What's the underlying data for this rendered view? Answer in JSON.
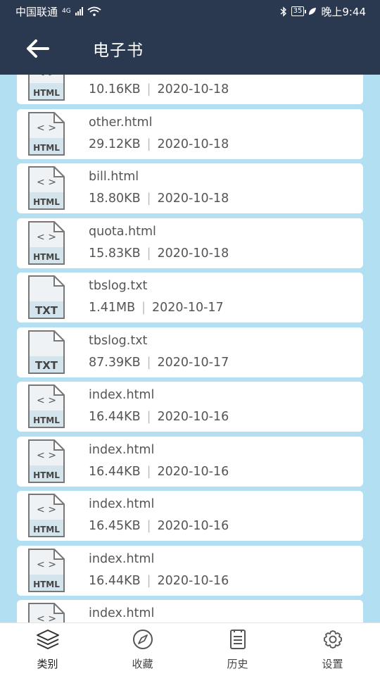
{
  "status": {
    "carrier": "中国联通",
    "net_label": "4G",
    "battery": "35",
    "time": "晚上9:44"
  },
  "header": {
    "title": "电子书",
    "back_icon": "arrow-left-icon"
  },
  "files": [
    {
      "name": "",
      "size": "10.16KB",
      "date": "2020-10-18",
      "type": "HTML"
    },
    {
      "name": "other.html",
      "size": "29.12KB",
      "date": "2020-10-18",
      "type": "HTML"
    },
    {
      "name": "bill.html",
      "size": "18.80KB",
      "date": "2020-10-18",
      "type": "HTML"
    },
    {
      "name": "quota.html",
      "size": "15.83KB",
      "date": "2020-10-18",
      "type": "HTML"
    },
    {
      "name": "tbslog.txt",
      "size": "1.41MB",
      "date": "2020-10-17",
      "type": "TXT"
    },
    {
      "name": "tbslog.txt",
      "size": "87.39KB",
      "date": "2020-10-17",
      "type": "TXT"
    },
    {
      "name": "index.html",
      "size": "16.44KB",
      "date": "2020-10-16",
      "type": "HTML"
    },
    {
      "name": "index.html",
      "size": "16.44KB",
      "date": "2020-10-16",
      "type": "HTML"
    },
    {
      "name": "index.html",
      "size": "16.45KB",
      "date": "2020-10-16",
      "type": "HTML"
    },
    {
      "name": "index.html",
      "size": "16.44KB",
      "date": "2020-10-16",
      "type": "HTML"
    },
    {
      "name": "index.html",
      "size": "",
      "date": "",
      "type": "HTML"
    }
  ],
  "meta_separator": "|",
  "nav": [
    {
      "label": "类别",
      "icon": "layers-icon",
      "active": true
    },
    {
      "label": "收藏",
      "icon": "compass-icon",
      "active": false
    },
    {
      "label": "历史",
      "icon": "document-list-icon",
      "active": false
    },
    {
      "label": "设置",
      "icon": "gear-icon",
      "active": false
    }
  ],
  "colors": {
    "header_bg": "#2b3950",
    "list_bg": "#b3dff2",
    "card_bg": "#ffffff"
  }
}
